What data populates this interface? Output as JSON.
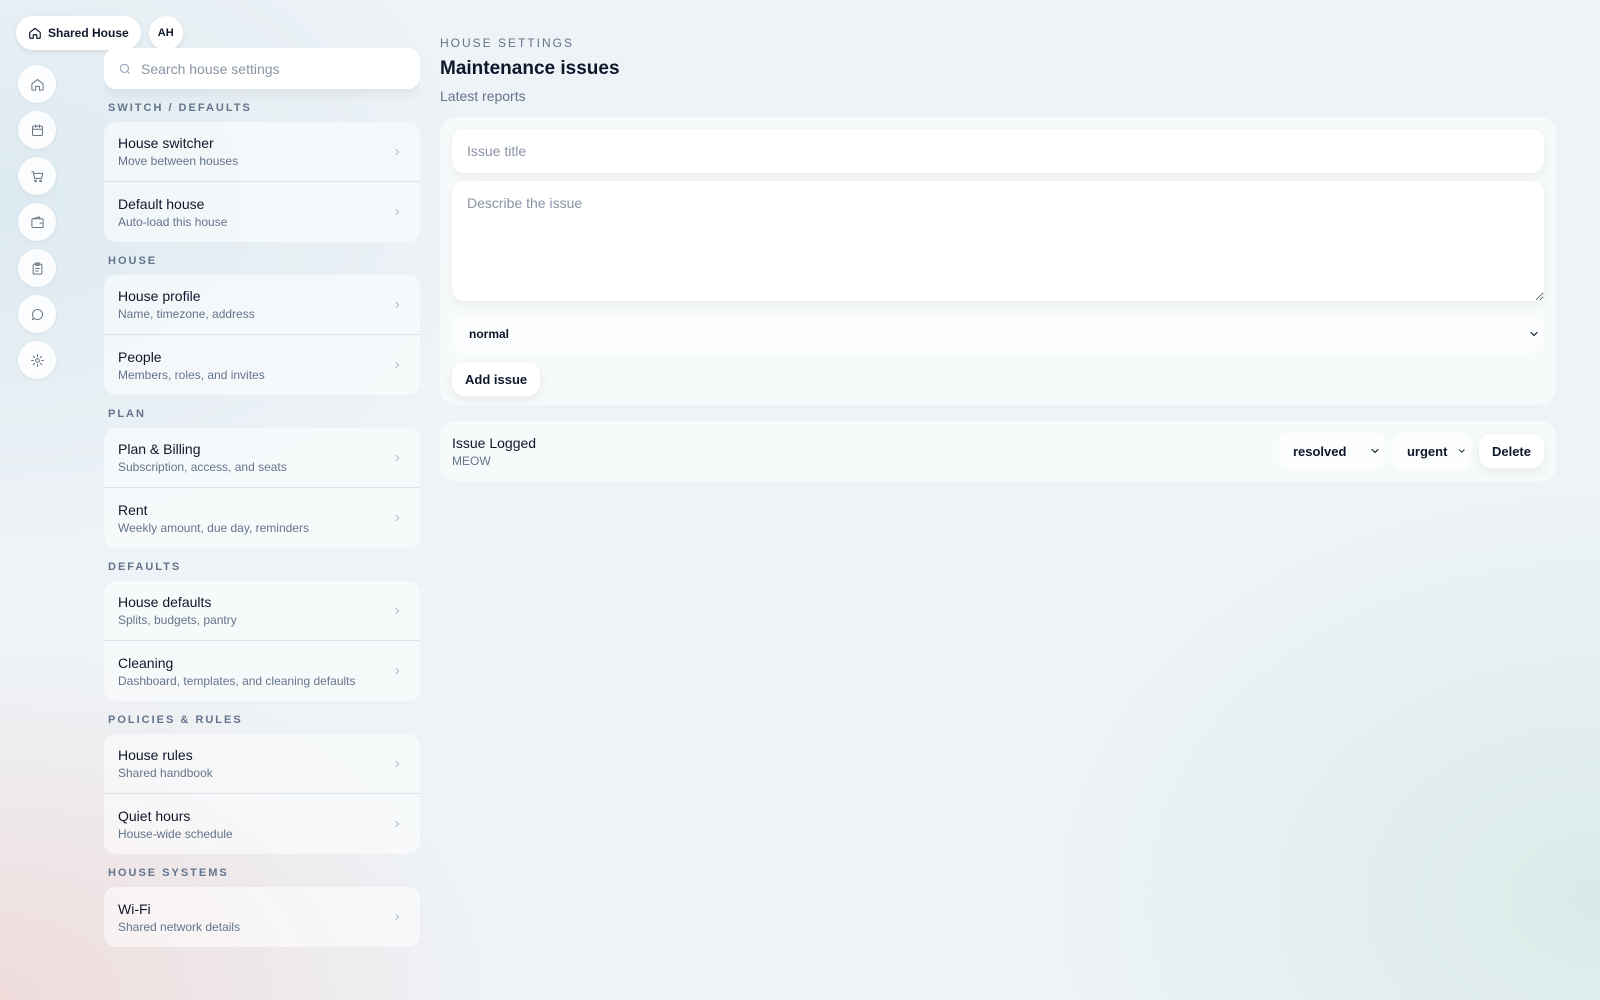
{
  "header": {
    "house_name": "Shared House",
    "avatar_initials": "AH"
  },
  "rail": {
    "icons": [
      "home-icon",
      "calendar-icon",
      "cart-icon",
      "wallet-icon",
      "clipboard-icon",
      "chat-icon",
      "gear-icon"
    ]
  },
  "search": {
    "placeholder": "Search house settings",
    "value": ""
  },
  "sections": [
    {
      "label": "SWITCH / DEFAULTS",
      "items": [
        {
          "title": "House switcher",
          "subtitle": "Move between houses"
        },
        {
          "title": "Default house",
          "subtitle": "Auto-load this house"
        }
      ]
    },
    {
      "label": "HOUSE",
      "items": [
        {
          "title": "House profile",
          "subtitle": "Name, timezone, address"
        },
        {
          "title": "People",
          "subtitle": "Members, roles, and invites"
        }
      ]
    },
    {
      "label": "PLAN",
      "items": [
        {
          "title": "Plan & Billing",
          "subtitle": "Subscription, access, and seats"
        },
        {
          "title": "Rent",
          "subtitle": "Weekly amount, due day, reminders"
        }
      ]
    },
    {
      "label": "DEFAULTS",
      "items": [
        {
          "title": "House defaults",
          "subtitle": "Splits, budgets, pantry"
        },
        {
          "title": "Cleaning",
          "subtitle": "Dashboard, templates, and cleaning defaults"
        }
      ]
    },
    {
      "label": "POLICIES & RULES",
      "items": [
        {
          "title": "House rules",
          "subtitle": "Shared handbook"
        },
        {
          "title": "Quiet hours",
          "subtitle": "House-wide schedule"
        }
      ]
    },
    {
      "label": "HOUSE SYSTEMS",
      "items": [
        {
          "title": "Wi-Fi",
          "subtitle": "Shared network details"
        }
      ]
    }
  ],
  "main": {
    "eyebrow": "HOUSE SETTINGS",
    "title": "Maintenance issues",
    "subtitle": "Latest reports",
    "form": {
      "title_placeholder": "Issue title",
      "description_placeholder": "Describe the issue",
      "priority_value": "normal",
      "add_label": "Add issue"
    },
    "issues": [
      {
        "title": "Issue Logged",
        "description": "MEOW",
        "status": "resolved",
        "priority": "urgent",
        "delete_label": "Delete"
      }
    ]
  }
}
